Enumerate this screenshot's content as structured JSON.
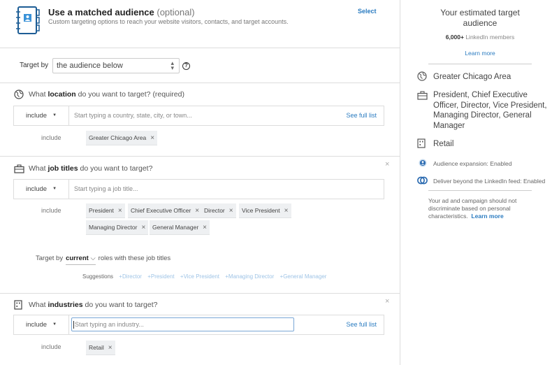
{
  "matched_audience": {
    "title": "Use a matched audience",
    "optional": "(optional)",
    "subtitle": "Custom targeting options to reach your website visitors, contacts, and target accounts.",
    "select_label": "Select"
  },
  "target_by": {
    "label": "Target by",
    "value": "the audience below",
    "help_icon": "question-circle-icon"
  },
  "location": {
    "title_pre": "What ",
    "title_bold": "location",
    "title_post": " do you want to target? (required)",
    "include_label": "include",
    "placeholder": "Start typing a country, state, city, or town...",
    "see_full_list": "See full list",
    "selected_label": "include",
    "selected": [
      "Greater Chicago Area"
    ]
  },
  "job_titles": {
    "title_pre": "What ",
    "title_bold": "job titles",
    "title_post": " do you want to target?",
    "include_label": "include",
    "placeholder": "Start typing a job title...",
    "selected_label": "include",
    "selected": [
      "President",
      "Chief Executive Officer",
      "Director",
      "Vice President",
      "Managing Director",
      "General Manager"
    ],
    "target_by_label": "Target by",
    "target_by_value": "current",
    "target_by_suffix": "roles with these job titles",
    "suggestions_label": "Suggestions",
    "suggestions": [
      "+Director",
      "+President",
      "+Vice President",
      "+Managing Director",
      "+General Manager"
    ]
  },
  "industries": {
    "title_pre": "What ",
    "title_bold": "industries",
    "title_post": " do you want to target?",
    "include_label": "include",
    "placeholder": "Start typing an industry...",
    "see_full_list": "See full list",
    "selected_label": "include",
    "selected": [
      "Retail"
    ]
  },
  "close_symbol": "×",
  "remove_symbol": "×",
  "sidebar": {
    "title": "Your estimated target audience",
    "count": "6,000+",
    "count_suffix": " LinkedIn members",
    "learn_more": "Learn more",
    "summary": [
      {
        "icon": "globe-icon",
        "text": "Greater Chicago Area"
      },
      {
        "icon": "briefcase-icon",
        "text": "President, Chief Executive Officer, Director, Vice President, Managing Director, General Manager"
      },
      {
        "icon": "building-icon",
        "text": "Retail"
      }
    ],
    "flags": [
      {
        "icon": "audience-expansion-icon",
        "text": "Audience expansion:  Enabled"
      },
      {
        "icon": "linkedin-network-icon",
        "text": "Deliver beyond the LinkedIn feed:  Enabled"
      }
    ],
    "disclaimer": "Your ad and campaign should not discriminate based on personal characteristics.",
    "disclaimer_link": "Learn more"
  },
  "colors": {
    "accent": "#2a7bc0",
    "border": "#dddddd",
    "pill_bg": "#eef0f2"
  }
}
